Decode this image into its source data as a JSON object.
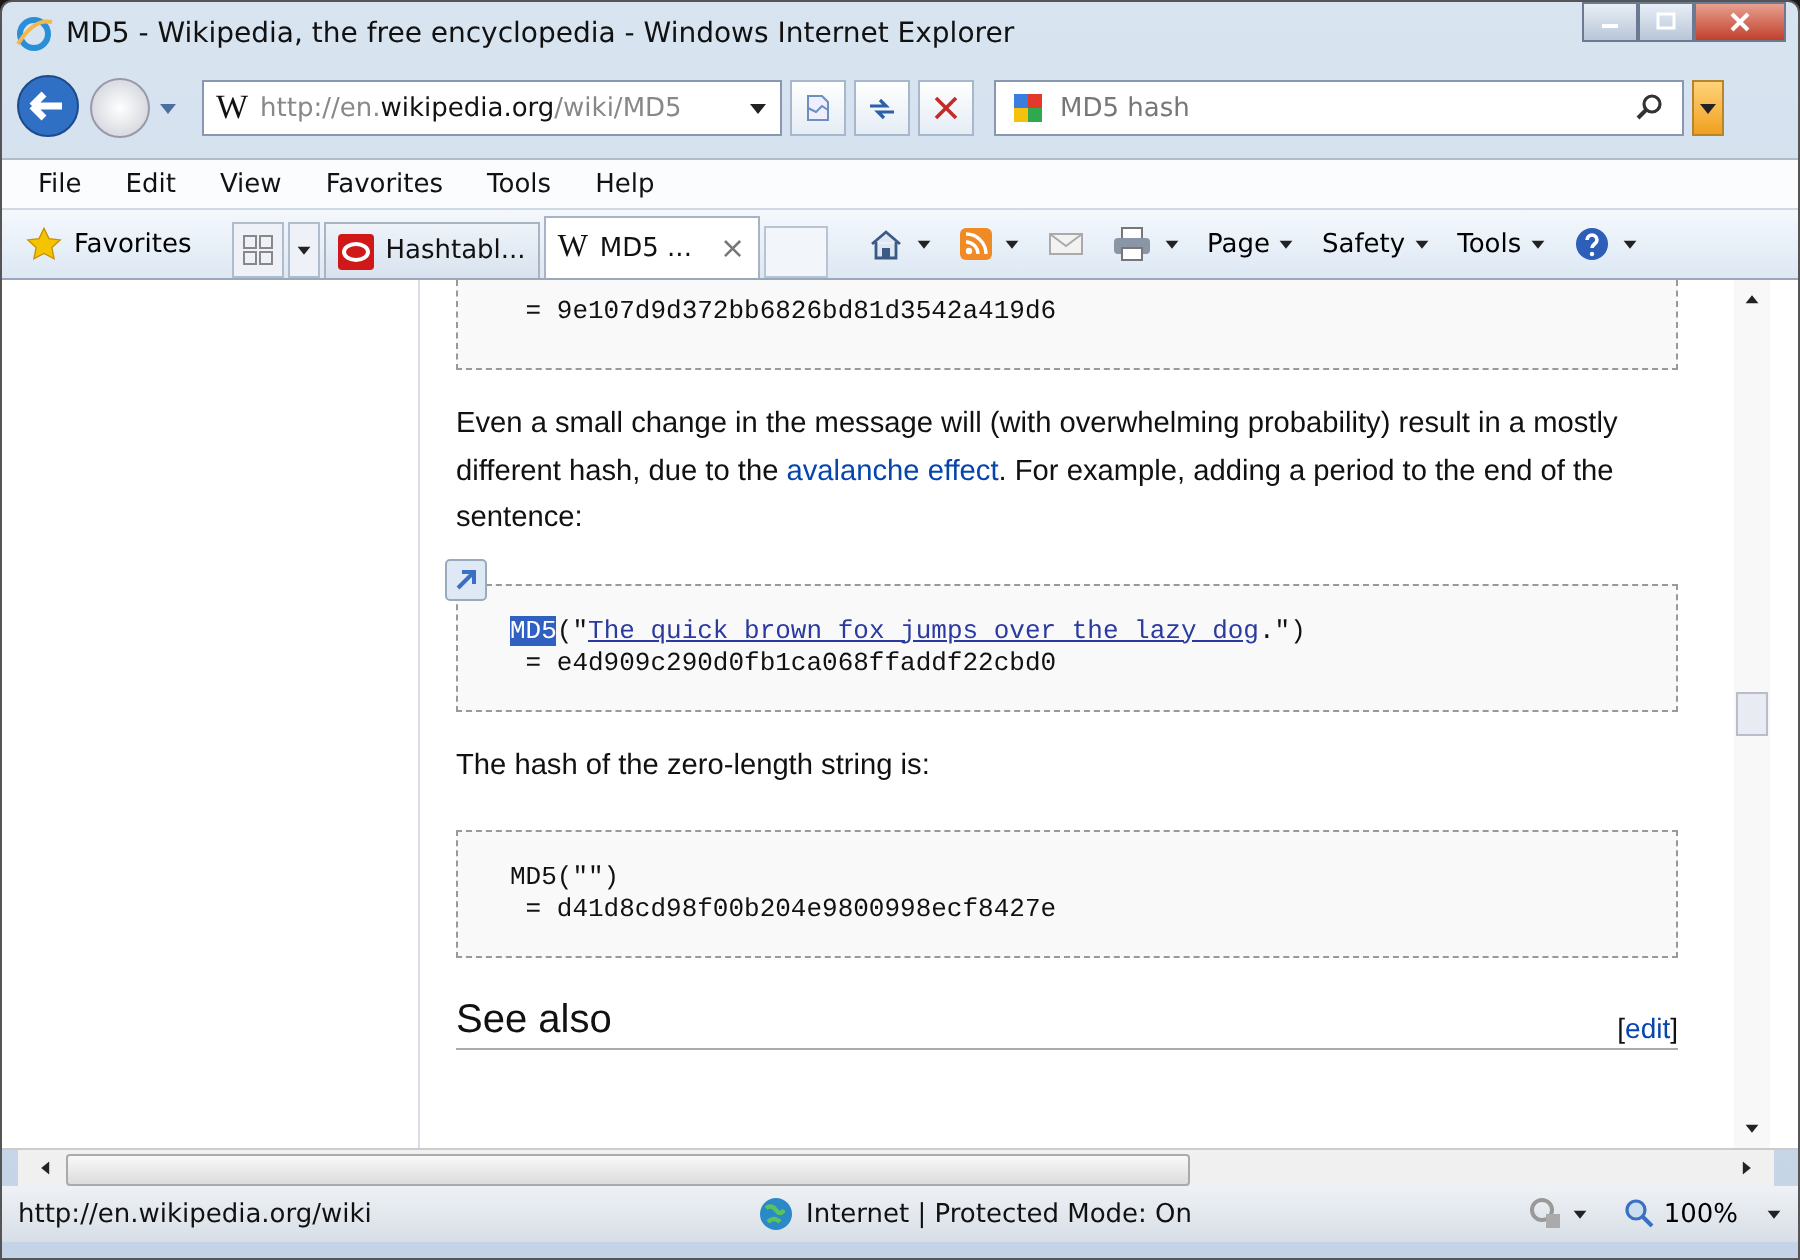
{
  "window": {
    "title": "MD5 - Wikipedia, the free encyclopedia - Windows Internet Explorer"
  },
  "address_bar": {
    "site_icon": "W",
    "url_prefix": "http://en.",
    "url_domain": "wikipedia.org",
    "url_path": "/wiki/MD5"
  },
  "search": {
    "value": "MD5 hash"
  },
  "menu": [
    "File",
    "Edit",
    "View",
    "Favorites",
    "Tools",
    "Help"
  ],
  "favorites_bar": {
    "label": "Favorites",
    "tabs": [
      {
        "label": "Hashtabl...",
        "kind": "oracle",
        "selected": false
      },
      {
        "label": "MD5 ...",
        "kind": "wiki",
        "icon_text": "W",
        "close": "×",
        "selected": true
      }
    ]
  },
  "command_bar": [
    "Page",
    "Safety",
    "Tools"
  ],
  "article": {
    "blocks": [
      {
        "kind": "code",
        "lines": [
          [
            {
              "text": " = 9e107d9d372bb6826bd81d3542a419d6"
            }
          ]
        ],
        "cut_top": true
      },
      {
        "kind": "para",
        "parts": [
          {
            "text": "Even a small change in the message will (with overwhelming probability) result in a mostly different hash, due to the "
          },
          {
            "text": "avalanche effect",
            "link": true
          },
          {
            "text": ". For example, adding a period to the end of the sentence:"
          }
        ]
      },
      {
        "kind": "code",
        "accelerator": true,
        "lines": [
          [
            {
              "text": "MD5",
              "selected": true
            },
            {
              "text": "(\""
            },
            {
              "text": "The quick brown fox jumps over the lazy dog",
              "link": true
            },
            {
              "text": ".\")"
            }
          ],
          [
            {
              "text": " = e4d909c290d0fb1ca068ffaddf22cbd0"
            }
          ]
        ]
      },
      {
        "kind": "para",
        "parts": [
          {
            "text": "The hash of the zero-length string is:"
          }
        ]
      },
      {
        "kind": "code",
        "lines": [
          [
            {
              "text": "MD5(\"\")"
            }
          ],
          [
            {
              "text": " = d41d8cd98f00b204e9800998ecf8427e"
            }
          ]
        ]
      },
      {
        "kind": "heading",
        "text": "See also",
        "edit_open": "[",
        "edit": "edit",
        "edit_close": "]"
      }
    ]
  },
  "status_bar": {
    "url": "http://en.wikipedia.org/wiki",
    "zone": "Internet | Protected Mode: On",
    "zoom": "100%"
  }
}
